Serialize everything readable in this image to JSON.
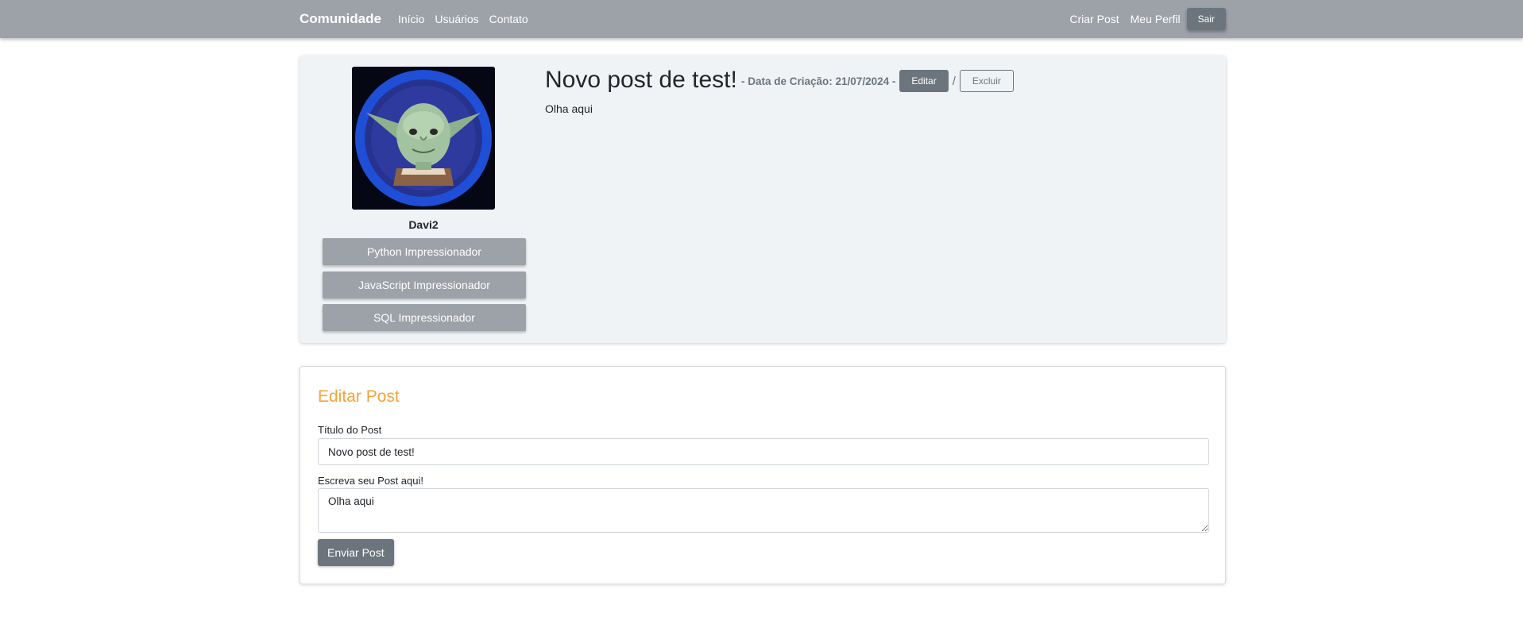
{
  "navbar": {
    "brand": "Comunidade",
    "links": [
      "Início",
      "Usuários",
      "Contato"
    ],
    "right_links": [
      "Criar Post",
      "Meu Perfil"
    ],
    "logout_label": "Sair"
  },
  "profile": {
    "avatar_icon": "yoda-avatar",
    "username": "Davi2",
    "badges": [
      "Python Impressionador",
      "JavaScript Impressionador",
      "SQL Impressionador"
    ]
  },
  "post": {
    "title": "Novo post de test!",
    "meta": "- Data de Criação: 21/07/2024 -",
    "edit_label": "Editar",
    "separator": "/",
    "delete_label": "Excluir",
    "body": "Olha aqui"
  },
  "edit_form": {
    "legend": "Editar Post",
    "title_label": "Título do Post",
    "title_value": "Novo post de test!",
    "body_label": "Escreva seu Post aqui!",
    "body_value": "Olha aqui",
    "submit_label": "Enviar Post"
  },
  "colors": {
    "navbar": "#9da1a8",
    "button_dark": "#6c757d",
    "legend_orange": "#f5a339",
    "card_bg": "#f0f3f6"
  }
}
